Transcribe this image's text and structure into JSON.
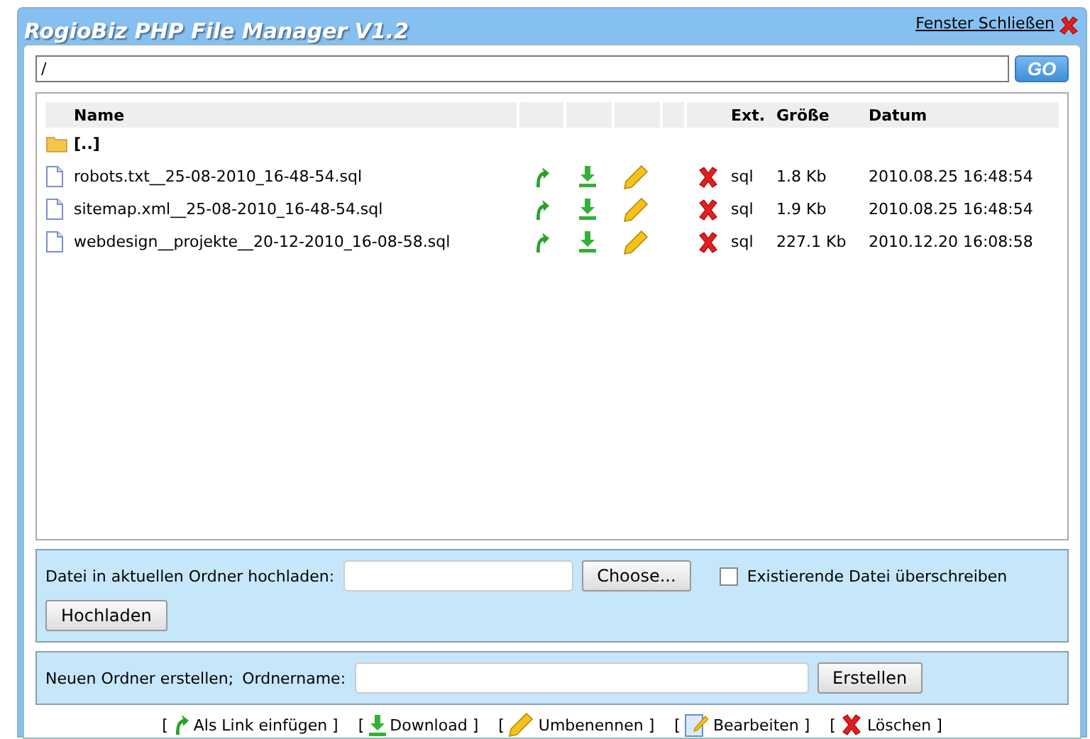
{
  "window": {
    "title": "RogioBiz PHP File Manager V1.2",
    "close_link": "Fenster Schließen"
  },
  "path": {
    "value": "/",
    "button": "GO"
  },
  "table": {
    "columns": [
      "Name",
      "Ext.",
      "Größe",
      "Datum"
    ],
    "rows": [
      {
        "kind": "parent",
        "name": "[..]"
      },
      {
        "kind": "file",
        "name": "robots.txt__25-08-2010_16-48-54.sql",
        "ext": "sql",
        "size": "1.8 Kb",
        "date": "2010.08.25 16:48:54"
      },
      {
        "kind": "file",
        "name": "sitemap.xml__25-08-2010_16-48-54.sql",
        "ext": "sql",
        "size": "1.9 Kb",
        "date": "2010.08.25 16:48:54"
      },
      {
        "kind": "file",
        "name": "webdesign__projekte__20-12-2010_16-08-58.sql",
        "ext": "sql",
        "size": "227.1 Kb",
        "date": "2010.12.20 16:08:58"
      }
    ]
  },
  "upload": {
    "label": "Datei in aktuellen Ordner hochladen:",
    "choose": "Choose...",
    "overwrite": {
      "label": "Existierende Datei überschreiben",
      "checked": false
    },
    "submit": "Hochladen"
  },
  "new_folder": {
    "label": "Neuen Ordner erstellen;",
    "name_label": "Ordnername:",
    "submit": "Erstellen"
  },
  "legend": [
    {
      "kind": "link",
      "open": "[",
      "label": "Als Link einfügen",
      "close": "]"
    },
    {
      "kind": "download",
      "open": "[",
      "label": "Download",
      "close": "]"
    },
    {
      "kind": "rename",
      "open": "[",
      "label": "Umbenennen",
      "close": "]"
    },
    {
      "kind": "edit",
      "open": "[",
      "label": "Bearbeiten",
      "close": "]"
    },
    {
      "kind": "delete",
      "open": "[",
      "label": "Löschen",
      "close": "]"
    }
  ]
}
